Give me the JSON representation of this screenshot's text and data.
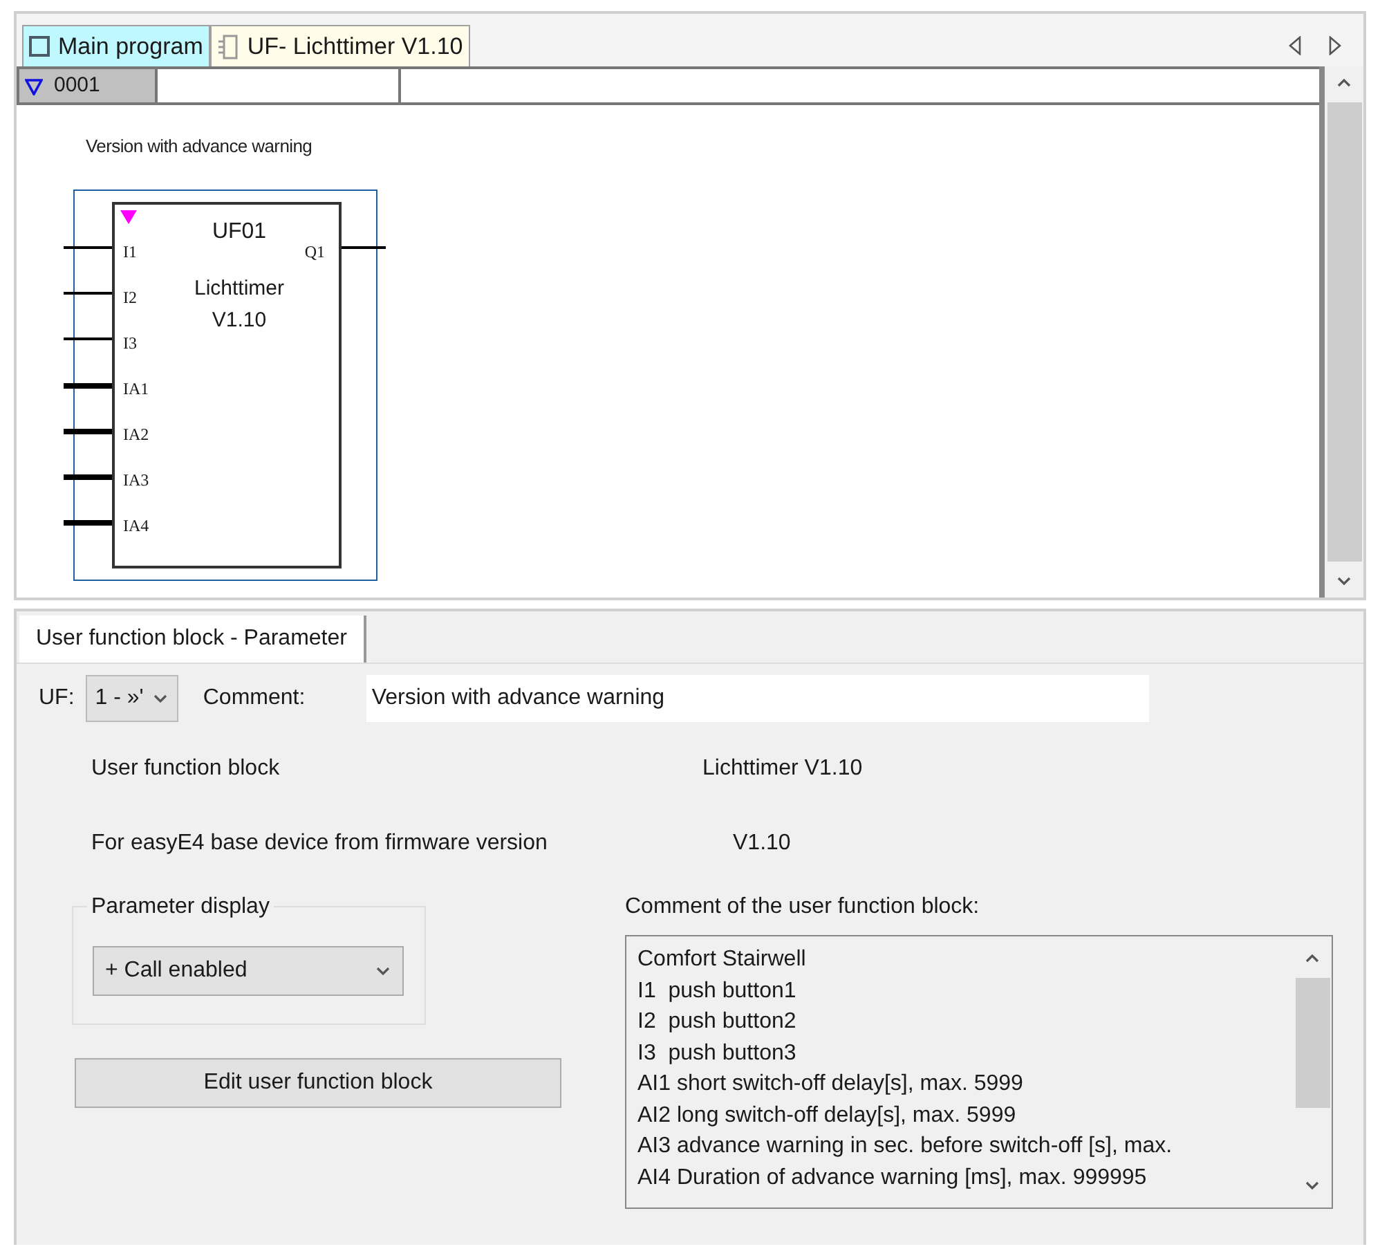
{
  "tabs": [
    {
      "label": "Main program",
      "kind": "program",
      "selected": true
    },
    {
      "label": "UF- Lichttimer V1.10",
      "kind": "module",
      "selected": false
    }
  ],
  "rung": {
    "number": "0001",
    "expanded": true
  },
  "canvas": {
    "comment": "Version with advance warning",
    "block": {
      "name": "UF01",
      "title": "Lichttimer",
      "version": "V1.10",
      "inputs": [
        "I1",
        "I2",
        "I3",
        "IA1",
        "IA2",
        "IA3",
        "IA4"
      ],
      "outputs": [
        "Q1"
      ]
    }
  },
  "panel": {
    "tab": "User function block - Parameter",
    "uf_label": "UF:",
    "uf_value": "1 - »'",
    "comment_label": "Comment:",
    "comment_value": "Version with advance warning",
    "info": [
      {
        "label": "User function block",
        "value": "Lichttimer V1.10"
      },
      {
        "label": "For easyE4 base device from firmware version",
        "value": "V1.10"
      }
    ],
    "display_group": "Parameter display",
    "display_value": "+ Call enabled",
    "edit_button": "Edit user function block",
    "comment_list_label": "Comment of the user function block:",
    "comment_lines": [
      "Comfort Stairwell",
      "I1  push button1",
      "I2  push button2",
      "I3  push button3",
      "AI1 short switch-off delay[s], max. 5999",
      "AI2 long switch-off delay[s], max. 5999",
      "AI3 advance warning in sec. before switch-off [s], max.",
      "AI4 Duration of advance warning [ms], max. 999995"
    ]
  }
}
